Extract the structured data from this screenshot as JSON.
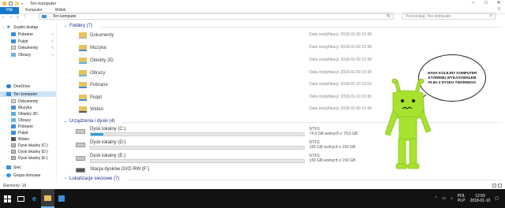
{
  "window": {
    "title": "Ten komputer"
  },
  "ribbon": {
    "tabs": [
      "Plik",
      "Komputer",
      "Widok"
    ]
  },
  "address": {
    "path": "Ten komputer",
    "search_placeholder": "Przeszukaj: Ten komputer"
  },
  "nav": {
    "quick_access": "Szybki dostęp",
    "quick_items": [
      "Pobrane",
      "Pulpit",
      "Dokumenty",
      "Obrazy"
    ],
    "onedrive": "OneDrive",
    "this_pc": "Ten komputer",
    "pc_items": [
      "Dokumenty",
      "Muzyka",
      "Obiekty 3D",
      "Obrazy",
      "Pobrane",
      "Pulpit",
      "Wideo",
      "Dysk lokalny (C:)",
      "Dysk lokalny (D:)",
      "Dysk lokalny (E:)"
    ],
    "network": "Sieć",
    "homegroup": "Grupa domowa"
  },
  "folders": {
    "header": "Foldery (7)",
    "items": [
      {
        "name": "Dokumenty",
        "meta": "Data modyfikacji: 2018-01-09 15:38"
      },
      {
        "name": "Muzyka",
        "meta": "Data modyfikacji: 2018-01-09 15:38"
      },
      {
        "name": "Obiekty 3D",
        "meta": "Data modyfikacji: 2018-01-09 15:38"
      },
      {
        "name": "Obrazy",
        "meta": "Data modyfikacji: 2018-01-09 15:38"
      },
      {
        "name": "Pobrane",
        "meta": "Data modyfikacji: 2018-01-10 10:53"
      },
      {
        "name": "Pulpit",
        "meta": "Data modyfikacji: 2018-01-10 10:36"
      },
      {
        "name": "Wideo",
        "meta": "Data modyfikacji: 2018-01-09 15:38"
      }
    ]
  },
  "devices": {
    "header": "Urządzenia i dyski (4)",
    "items": [
      {
        "name": "Dysk lokalny (C:)",
        "fs": "NTFS",
        "free": "74,6 GB wolnych z 79,6 GB",
        "used_fraction": 0.06
      },
      {
        "name": "Dysk lokalny (D:)",
        "fs": "NTFS",
        "free": "150 GB wolnych z 150 GB",
        "used_fraction": 0.0
      },
      {
        "name": "Dysk lokalny (E:)",
        "fs": "NTFS",
        "free": "150 GB wolnych z 150 GB",
        "used_fraction": 0.0
      },
      {
        "name": "Stacja dysków DVD RW (F:)",
        "fs": "",
        "free": "",
        "used_fraction": 0.0
      }
    ]
  },
  "network_group": {
    "header": "Lokalizacje sieciowe (7)"
  },
  "bubble": {
    "text": "HAHA KOLEJNY KOMPUTER KTÓREMU WYKASOWAŁEM PLIKI Z DYSKU TWARDEGO"
  },
  "status": {
    "items": "Elementy: 18"
  },
  "taskbar": {
    "lang_top": "POL",
    "lang_bottom": "PLP",
    "time": "12:59",
    "date": "2018-01-10"
  },
  "colors": {
    "accent": "#1979ca",
    "folder": "#e8c25c",
    "robot": "#a6e22e",
    "taskbar": "#121212",
    "selection": "#cce4f7"
  }
}
